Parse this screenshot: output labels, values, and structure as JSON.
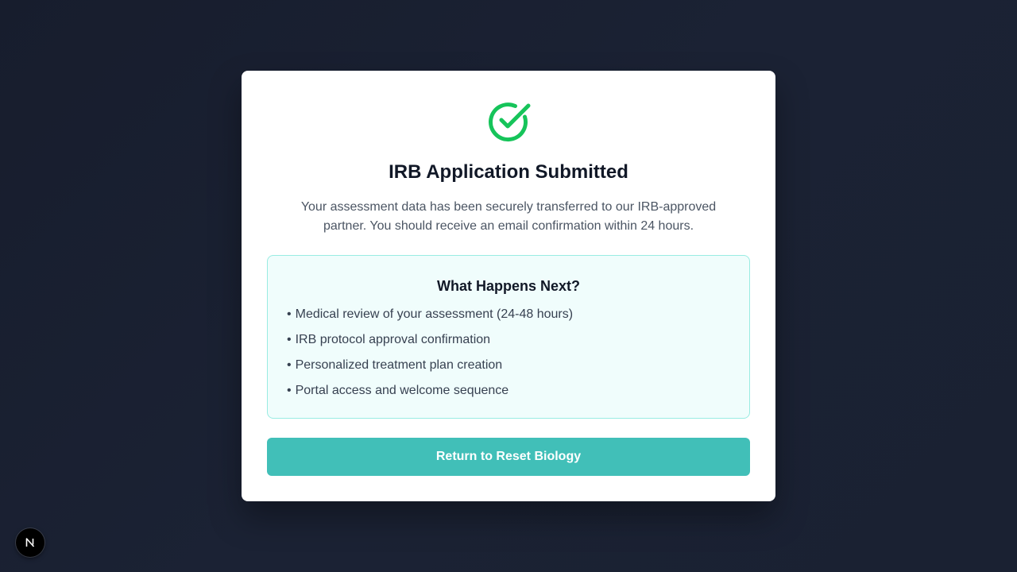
{
  "colors": {
    "background": "#1a2132",
    "card": "#ffffff",
    "success": "#16c45a",
    "accent": "#41bfb8",
    "info_box_bg": "#f0fdfc",
    "info_box_border": "#99ece2"
  },
  "success_icon": "check-circle-icon",
  "card": {
    "title": "IRB Application Submitted",
    "description": "Your assessment data has been securely transferred to our IRB-approved partner. You should receive an email confirmation within 24 hours."
  },
  "next_steps": {
    "heading": "What Happens Next?",
    "bullet": "•",
    "items": [
      "Medical review of your assessment (24-48 hours)",
      "IRB protocol approval confirmation",
      "Personalized treatment plan creation",
      "Portal access and welcome sequence"
    ]
  },
  "actions": {
    "return_label": "Return to Reset Biology"
  },
  "dev_badge": {
    "icon": "nextjs-logo-icon",
    "letter": "N"
  }
}
